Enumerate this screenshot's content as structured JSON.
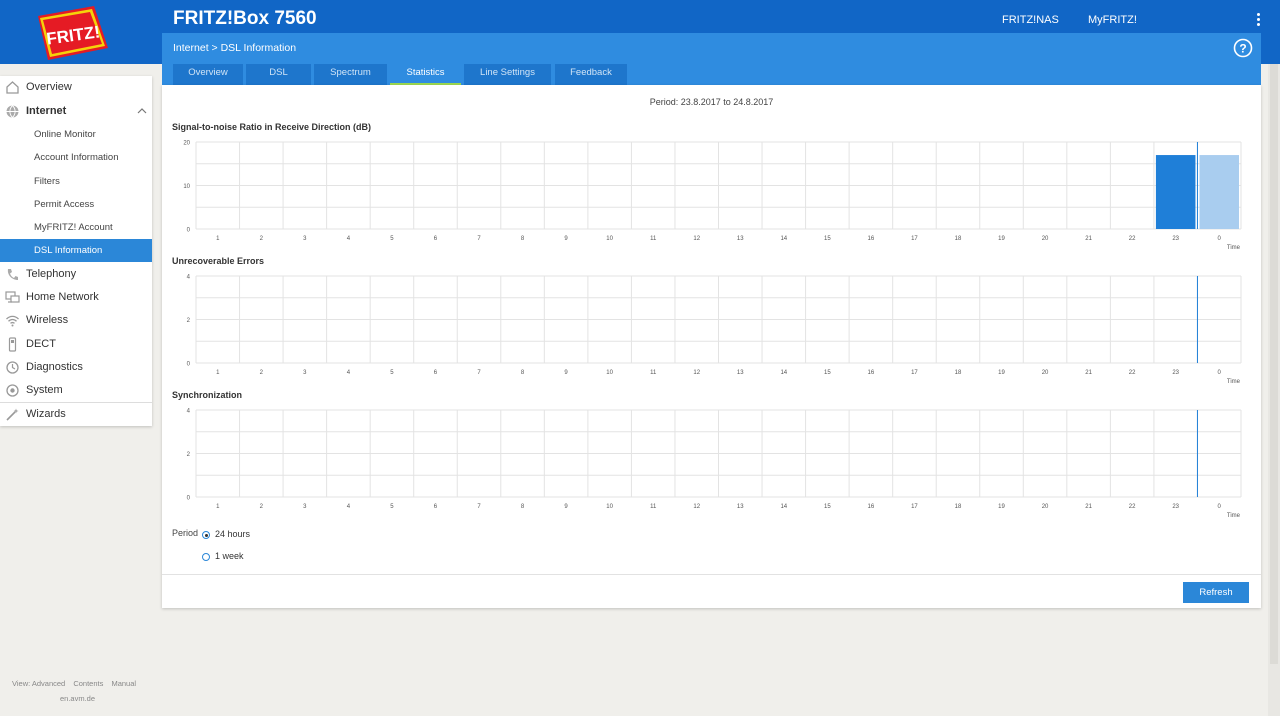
{
  "header": {
    "product": "FRITZ!Box 7560",
    "logo_text": "FRITZ!",
    "links": [
      "FRITZ!NAS",
      "MyFRITZ!"
    ],
    "brand_color": "#1166c6"
  },
  "breadcrumb": {
    "parent": "Internet",
    "separator": ">",
    "current": "DSL Information"
  },
  "tabs": [
    {
      "label": "Overview"
    },
    {
      "label": "DSL"
    },
    {
      "label": "Spectrum"
    },
    {
      "label": "Statistics",
      "active": true
    },
    {
      "label": "Line Settings"
    },
    {
      "label": "Feedback"
    }
  ],
  "sidebar": {
    "items": [
      {
        "label": "Overview",
        "icon": "home-icon"
      },
      {
        "label": "Internet",
        "icon": "globe-icon",
        "expanded": true
      },
      {
        "label": "Online Monitor"
      },
      {
        "label": "Account Information"
      },
      {
        "label": "Filters"
      },
      {
        "label": "Permit Access"
      },
      {
        "label": "MyFRITZ! Account"
      },
      {
        "label": "DSL Information",
        "active": true
      },
      {
        "label": "Telephony",
        "icon": "phone-icon"
      },
      {
        "label": "Home Network",
        "icon": "network-icon"
      },
      {
        "label": "Wireless",
        "icon": "wifi-icon"
      },
      {
        "label": "DECT",
        "icon": "dect-icon"
      },
      {
        "label": "Diagnostics",
        "icon": "diagnostics-icon"
      },
      {
        "label": "System",
        "icon": "system-icon"
      },
      {
        "label": "Wizards",
        "icon": "wizard-icon"
      }
    ]
  },
  "main": {
    "period_text": "Period: 23.8.2017 to 24.8.2017",
    "period_label": "Period",
    "period_options": [
      {
        "label": "24 hours",
        "checked": true
      },
      {
        "label": "1 week",
        "checked": false
      }
    ],
    "refresh_label": "Refresh"
  },
  "footer": {
    "links": [
      "View: Advanced",
      "Contents",
      "Manual"
    ],
    "site": "en.avm.de"
  },
  "chart_data": [
    {
      "type": "bar",
      "title": "Signal-to-noise Ratio in Receive Direction (dB)",
      "xlabel": "Time",
      "categories": [
        "1",
        "2",
        "3",
        "4",
        "5",
        "6",
        "7",
        "8",
        "9",
        "10",
        "11",
        "12",
        "13",
        "14",
        "15",
        "16",
        "17",
        "18",
        "19",
        "20",
        "21",
        "22",
        "23",
        "0"
      ],
      "series": [
        {
          "values": [
            null,
            null,
            null,
            null,
            null,
            null,
            null,
            null,
            null,
            null,
            null,
            null,
            null,
            null,
            null,
            null,
            null,
            null,
            null,
            null,
            null,
            null,
            17,
            17
          ]
        }
      ],
      "yticks": [
        0,
        10,
        20
      ],
      "ylim": [
        0,
        20
      ],
      "current_hour_index": 23,
      "colors": {
        "bar": "#1f7fd8",
        "current": "#a9cdef",
        "marker": "#1f7fd8"
      }
    },
    {
      "type": "bar",
      "title": "Unrecoverable Errors",
      "xlabel": "Time",
      "categories": [
        "1",
        "2",
        "3",
        "4",
        "5",
        "6",
        "7",
        "8",
        "9",
        "10",
        "11",
        "12",
        "13",
        "14",
        "15",
        "16",
        "17",
        "18",
        "19",
        "20",
        "21",
        "22",
        "23",
        "0"
      ],
      "series": [
        {
          "values": [
            null,
            null,
            null,
            null,
            null,
            null,
            null,
            null,
            null,
            null,
            null,
            null,
            null,
            null,
            null,
            null,
            null,
            null,
            null,
            null,
            null,
            null,
            null,
            null
          ]
        }
      ],
      "yticks": [
        0,
        2,
        4
      ],
      "ylim": [
        0,
        4
      ],
      "current_hour_index": 23,
      "colors": {
        "bar": "#1f7fd8",
        "current": "#a9cdef",
        "marker": "#1f7fd8"
      }
    },
    {
      "type": "bar",
      "title": "Synchronization",
      "xlabel": "Time",
      "categories": [
        "1",
        "2",
        "3",
        "4",
        "5",
        "6",
        "7",
        "8",
        "9",
        "10",
        "11",
        "12",
        "13",
        "14",
        "15",
        "16",
        "17",
        "18",
        "19",
        "20",
        "21",
        "22",
        "23",
        "0"
      ],
      "series": [
        {
          "values": [
            null,
            null,
            null,
            null,
            null,
            null,
            null,
            null,
            null,
            null,
            null,
            null,
            null,
            null,
            null,
            null,
            null,
            null,
            null,
            null,
            null,
            null,
            null,
            null
          ]
        }
      ],
      "yticks": [
        0,
        2,
        4
      ],
      "ylim": [
        0,
        4
      ],
      "current_hour_index": 23,
      "colors": {
        "bar": "#1f7fd8",
        "current": "#a9cdef",
        "marker": "#1f7fd8"
      }
    }
  ]
}
